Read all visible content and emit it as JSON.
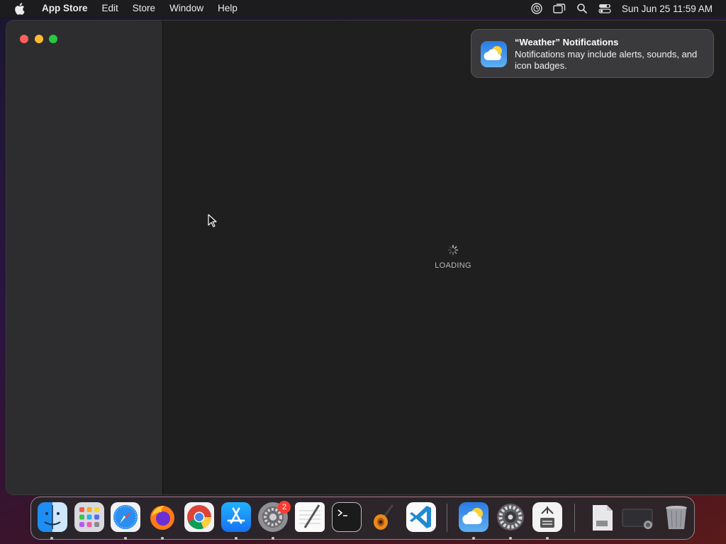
{
  "menubar": {
    "app_name": "App Store",
    "items": [
      "Edit",
      "Store",
      "Window",
      "Help"
    ],
    "clock": "Sun Jun 25  11:59 AM",
    "status_icons": [
      "screen-time-icon",
      "window-icon",
      "search-icon",
      "control-center-icon"
    ]
  },
  "main": {
    "loading_label": "LOADING"
  },
  "notification": {
    "title": "“Weather” Notifications",
    "body": "Notifications may include alerts, sounds, and icon badges.",
    "app_icon": "weather-icon"
  },
  "dock": {
    "items": [
      {
        "name": "finder-icon",
        "running": true
      },
      {
        "name": "launchpad-icon",
        "running": false
      },
      {
        "name": "safari-icon",
        "running": true
      },
      {
        "name": "firefox-icon",
        "running": true
      },
      {
        "name": "chrome-icon",
        "running": false
      },
      {
        "name": "app-store-icon",
        "running": true
      },
      {
        "name": "system-settings-icon",
        "running": true,
        "badge": "2"
      },
      {
        "name": "textedit-icon",
        "running": false
      },
      {
        "name": "terminal-icon",
        "running": false
      },
      {
        "name": "garageband-icon",
        "running": false
      },
      {
        "name": "vscode-icon",
        "running": false
      },
      {
        "name": "weather-icon",
        "running": true
      },
      {
        "name": "system-preferences-icon",
        "running": true
      },
      {
        "name": "archive-utility-icon",
        "running": true
      },
      {
        "name": "document-file-icon",
        "running": false
      },
      {
        "name": "screenshot-folder-icon",
        "running": false
      },
      {
        "name": "trash-icon",
        "running": false
      }
    ]
  },
  "colors": {
    "close": "#fe5f57",
    "minimize": "#febc2e",
    "maximize": "#28c840",
    "badge": "#ff3b30"
  }
}
